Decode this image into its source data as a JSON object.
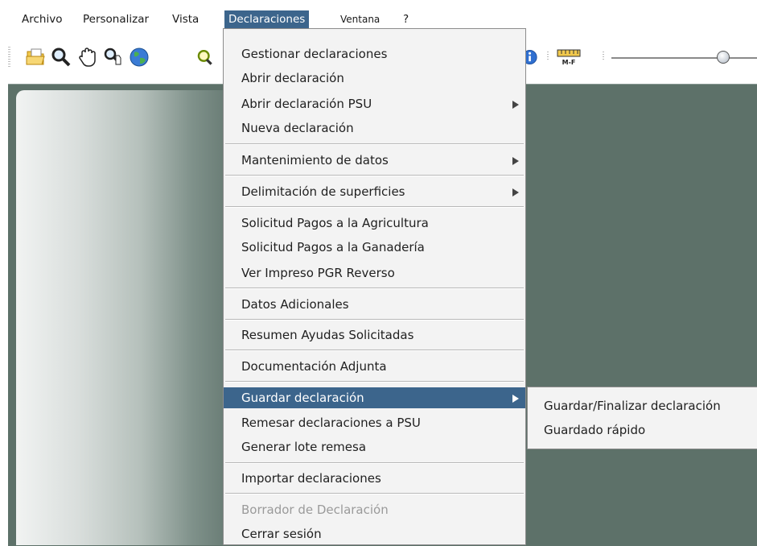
{
  "menubar": {
    "items": [
      {
        "label": "Archivo"
      },
      {
        "label": "Personalizar"
      },
      {
        "label": "Vista"
      },
      {
        "label": "Declaraciones"
      },
      {
        "label": "Ventana"
      },
      {
        "label": "?"
      }
    ],
    "active": "Declaraciones"
  },
  "toolbar": {
    "icons": [
      "folder-open-icon",
      "zoom-icon",
      "pan-hand-icon",
      "zoom-select-icon",
      "globe-icon",
      "zoom-extent-icon",
      "info-icon",
      "ruler-icon"
    ],
    "ruler_label": "M-F"
  },
  "declaraciones_menu": {
    "items": [
      {
        "label": "Gestionar declaraciones"
      },
      {
        "label": "Abrir declaración"
      },
      {
        "label": "Abrir declaración PSU",
        "submenu": true
      },
      {
        "label": "Nueva declaración"
      },
      {
        "label": "Mantenimiento de datos",
        "submenu": true
      },
      {
        "label": "Delimitación de superficies",
        "submenu": true
      },
      {
        "label": "Solicitud Pagos a la Agricultura"
      },
      {
        "label": "Solicitud Pagos a la Ganadería"
      },
      {
        "label": "Ver Impreso PGR Reverso"
      },
      {
        "label": "Datos Adicionales"
      },
      {
        "label": "Resumen Ayudas Solicitadas"
      },
      {
        "label": "Documentación Adjunta"
      },
      {
        "label": "Guardar declaración",
        "submenu": true,
        "selected": true
      },
      {
        "label": "Remesar declaraciones a PSU"
      },
      {
        "label": "Generar lote remesa"
      },
      {
        "label": "Importar declaraciones"
      },
      {
        "label": "Borrador de Declaración",
        "disabled": true
      },
      {
        "label": "Cerrar sesión"
      }
    ]
  },
  "guardar_submenu": {
    "items": [
      {
        "label": "Guardar/Finalizar declaración"
      },
      {
        "label": "Guardado rápido"
      }
    ]
  },
  "colors": {
    "selection": "#3c658c",
    "workspace": "#5d7169",
    "menu_bg": "#f3f3f3"
  }
}
